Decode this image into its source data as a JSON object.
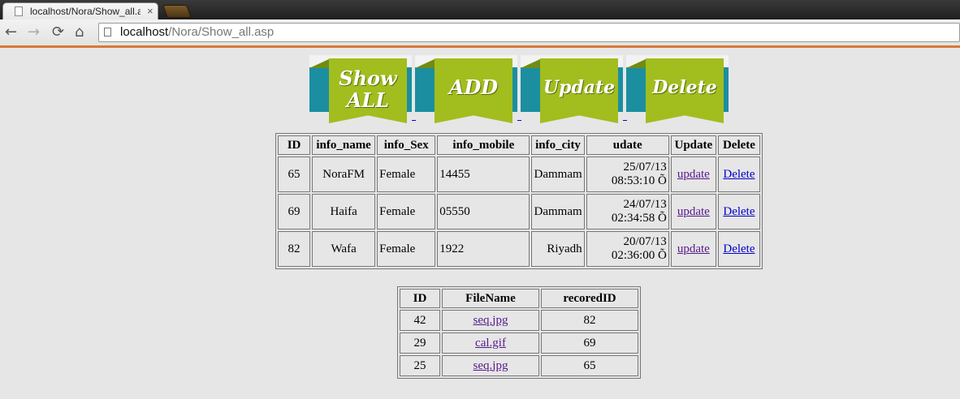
{
  "browser": {
    "tab_title": "localhost/Nora/Show_all.a",
    "tab_close": "×",
    "url_host": "localhost",
    "url_path": "/Nora/Show_all.asp",
    "icons": {
      "back": "←",
      "forward": "→",
      "reload": "⟳",
      "home": "⌂"
    }
  },
  "nav_buttons": [
    {
      "line1": "Show",
      "line2": "ALL"
    },
    {
      "line1": "ADD",
      "line2": ""
    },
    {
      "line1": "Update",
      "line2": ""
    },
    {
      "line1": "Delete",
      "line2": ""
    }
  ],
  "colors": {
    "banner": "#a2bd1e",
    "band": "#1b8ea0",
    "accent": "#d87a36"
  },
  "main_table": {
    "headers": [
      "ID",
      "info_name",
      "info_Sex",
      "info_mobile",
      "info_city",
      "udate",
      "Update",
      "Delete"
    ],
    "rows": [
      {
        "id": "65",
        "name": "NoraFM",
        "sex": "Female",
        "mobile": "14455",
        "city": "Dammam",
        "date": "25/07/13",
        "time": "08:53:10 Õ",
        "update": "update",
        "delete": "Delete"
      },
      {
        "id": "69",
        "name": "Haifa",
        "sex": "Female",
        "mobile": "05550",
        "city": "Dammam",
        "date": "24/07/13",
        "time": "02:34:58 Õ",
        "update": "update",
        "delete": "Delete"
      },
      {
        "id": "82",
        "name": "Wafa",
        "sex": "Female",
        "mobile": "1922",
        "city": "Riyadh",
        "date": "20/07/13",
        "time": "02:36:00 Õ",
        "update": "update",
        "delete": "Delete"
      }
    ]
  },
  "files_table": {
    "headers": [
      "ID",
      "FileName",
      "recoredID"
    ],
    "rows": [
      {
        "id": "42",
        "file": "seq.jpg",
        "record": "82"
      },
      {
        "id": "29",
        "file": "cal.gif",
        "record": "69"
      },
      {
        "id": "25",
        "file": "seq.jpg",
        "record": "65"
      }
    ]
  }
}
